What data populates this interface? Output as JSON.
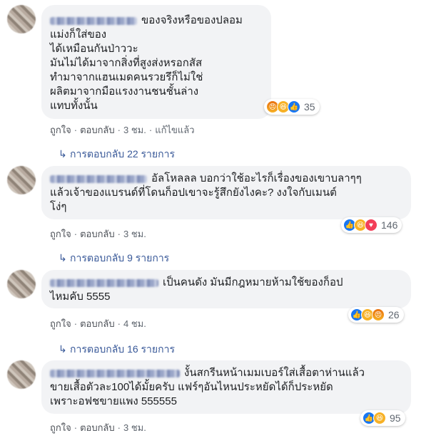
{
  "comments": [
    {
      "text": "ของจริงหรือของปลอม\nแม่งก็ใส่ของ\nได้เหมือนกันป่าววะ\nมันไม่ได้มาจากสิ่งที่สูงส่งหรอกสัส\nทำมาจากแฮนเมดคนรวยรึก็ไม่ใช่\nผลิตมาจากมือแรงงานชนชั้นล่าง\nแทบทั้งนั้น",
      "reactions": [
        "angry-icon",
        "haha-icon",
        "like-icon"
      ],
      "reaction_count": "35",
      "like": "ถูกใจ",
      "reply": "ตอบกลับ",
      "time": "3 ชม.",
      "edited": "แก้ไขแล้ว",
      "replies_label": "การตอบกลับ 22 รายการ"
    },
    {
      "text": "อัลโหลลล บอกว่าใช้อะไรก็เรื่องของเขาบลาๆๆ\nแล้วเจ้าของแบรนด์ที่โดนก็อปเขาจะรู้สึกยังไงคะ? งงใจกับเมนต์\nโง่ๆ",
      "reactions": [
        "like-icon",
        "haha-icon",
        "love-icon"
      ],
      "reaction_count": "146",
      "like": "ถูกใจ",
      "reply": "ตอบกลับ",
      "time": "3 ชม.",
      "replies_label": "การตอบกลับ 9 รายการ"
    },
    {
      "text": "เป็นคนดัง มันมีกฎหมายห้ามใช้ของก็อป\nไหมคับ 5555",
      "reactions": [
        "like-icon",
        "haha-icon",
        "angry-icon"
      ],
      "reaction_count": "26",
      "like": "ถูกใจ",
      "reply": "ตอบกลับ",
      "time": "4 ชม.",
      "replies_label": "การตอบกลับ 16 รายการ"
    },
    {
      "text": "งั้นสกรีนหน้าเมมเบอร์ใส่เสื้อตาห่านแล้ว\nขายเสื้อตัวละ100ได้มั้ยครับ แฟร์ๆอันไหนประหยัดได้ก็ประหยัด\nเพราะอฟชขายแพง 555555",
      "reactions": [
        "like-icon",
        "haha-icon"
      ],
      "reaction_count": "95",
      "like": "ถูกใจ",
      "reply": "ตอบกลับ",
      "time": "3 ชม."
    }
  ],
  "colors": {
    "bubble": "#f2f3f5",
    "link": "#385898",
    "meta": "#606770"
  }
}
